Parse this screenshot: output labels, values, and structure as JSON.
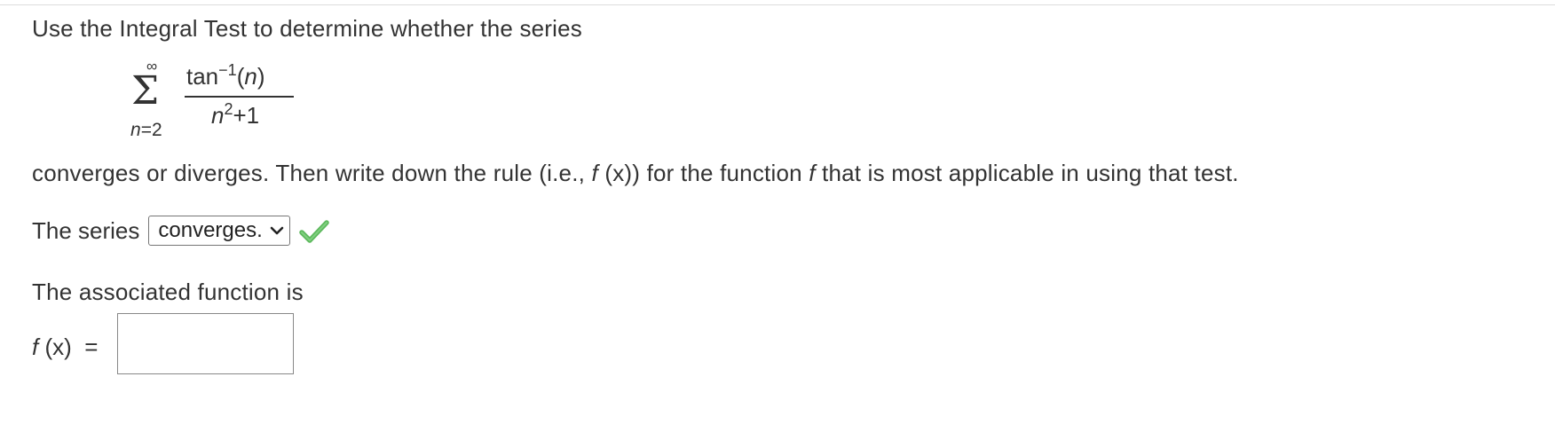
{
  "question": {
    "intro": "Use the Integral Test to determine whether the series",
    "series": {
      "upper_limit": "∞",
      "sigma": "Σ",
      "lower_var": "n",
      "lower_eq": "=2",
      "numerator_fn": "tan",
      "numerator_exp": "−1",
      "numerator_arg_open": "(",
      "numerator_arg": "n",
      "numerator_arg_close": ")",
      "denominator_var": "n",
      "denominator_exp": "2",
      "denominator_tail": "+1"
    },
    "instruction": {
      "part1": "converges or diverges. Then write down the rule (i.e., ",
      "f": "f",
      "x_paren": " (x)",
      "part2": ") for the function ",
      "f2": "f",
      "part3": " that is most applicable in using that test."
    },
    "series_label": "The series",
    "series_select": {
      "selected_value": "converges.",
      "status": "correct"
    },
    "assoc_label": "The associated function is",
    "fx_label": {
      "f": "f",
      "rest": " (x)  ="
    },
    "answer_input": {
      "value": ""
    }
  },
  "colors": {
    "text": "#333333",
    "check_green": "#5cb85c"
  }
}
